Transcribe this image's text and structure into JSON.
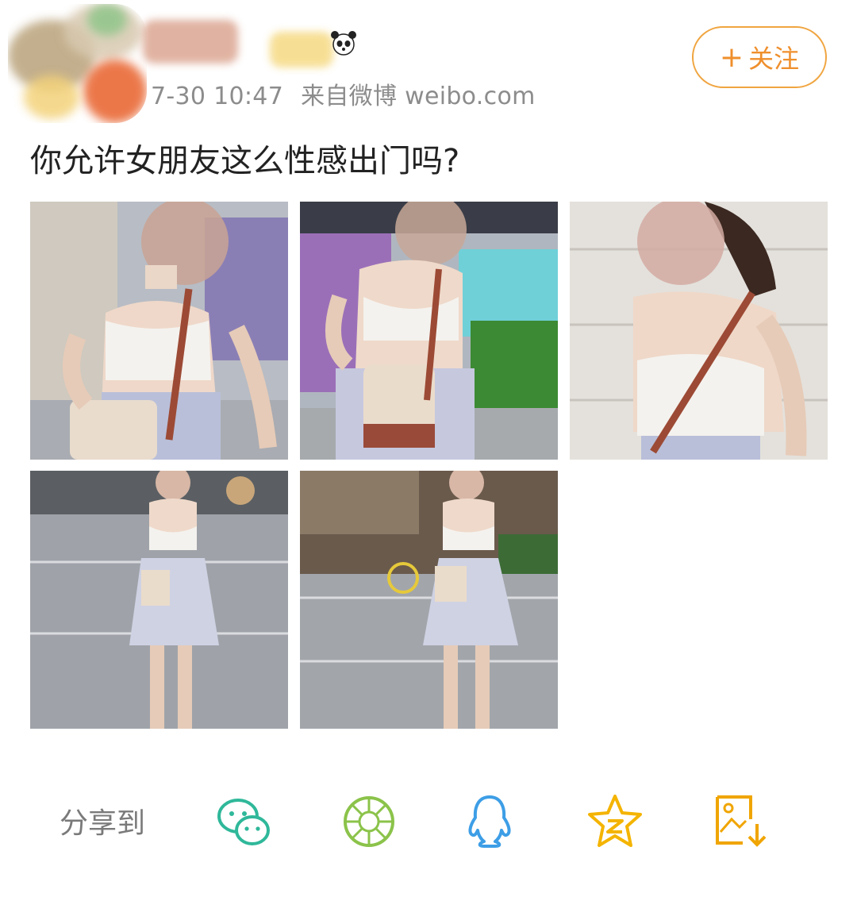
{
  "post": {
    "meta": {
      "date": "7-30 10:47",
      "source": "来自微博 weibo.com"
    },
    "follow_label": "关注",
    "text": "你允许女朋友这么性感出门吗?",
    "photos": [
      {
        "icon": "photo-street-woman"
      },
      {
        "icon": "photo-street-woman"
      },
      {
        "icon": "photo-street-woman"
      },
      {
        "icon": "photo-street-woman"
      },
      {
        "icon": "photo-street-woman"
      }
    ]
  },
  "share": {
    "label": "分享到",
    "targets": [
      {
        "icon": "wechat-icon",
        "color": "#2fb89a"
      },
      {
        "icon": "moments-icon",
        "color": "#8bc34a"
      },
      {
        "icon": "qq-icon",
        "color": "#3d9ee6"
      },
      {
        "icon": "qzone-icon",
        "color": "#f4b400"
      },
      {
        "icon": "save-image-icon",
        "color": "#f0a500"
      }
    ]
  },
  "colors": {
    "accent": "#ef8f2c",
    "meta_text": "#8c8c8c"
  }
}
